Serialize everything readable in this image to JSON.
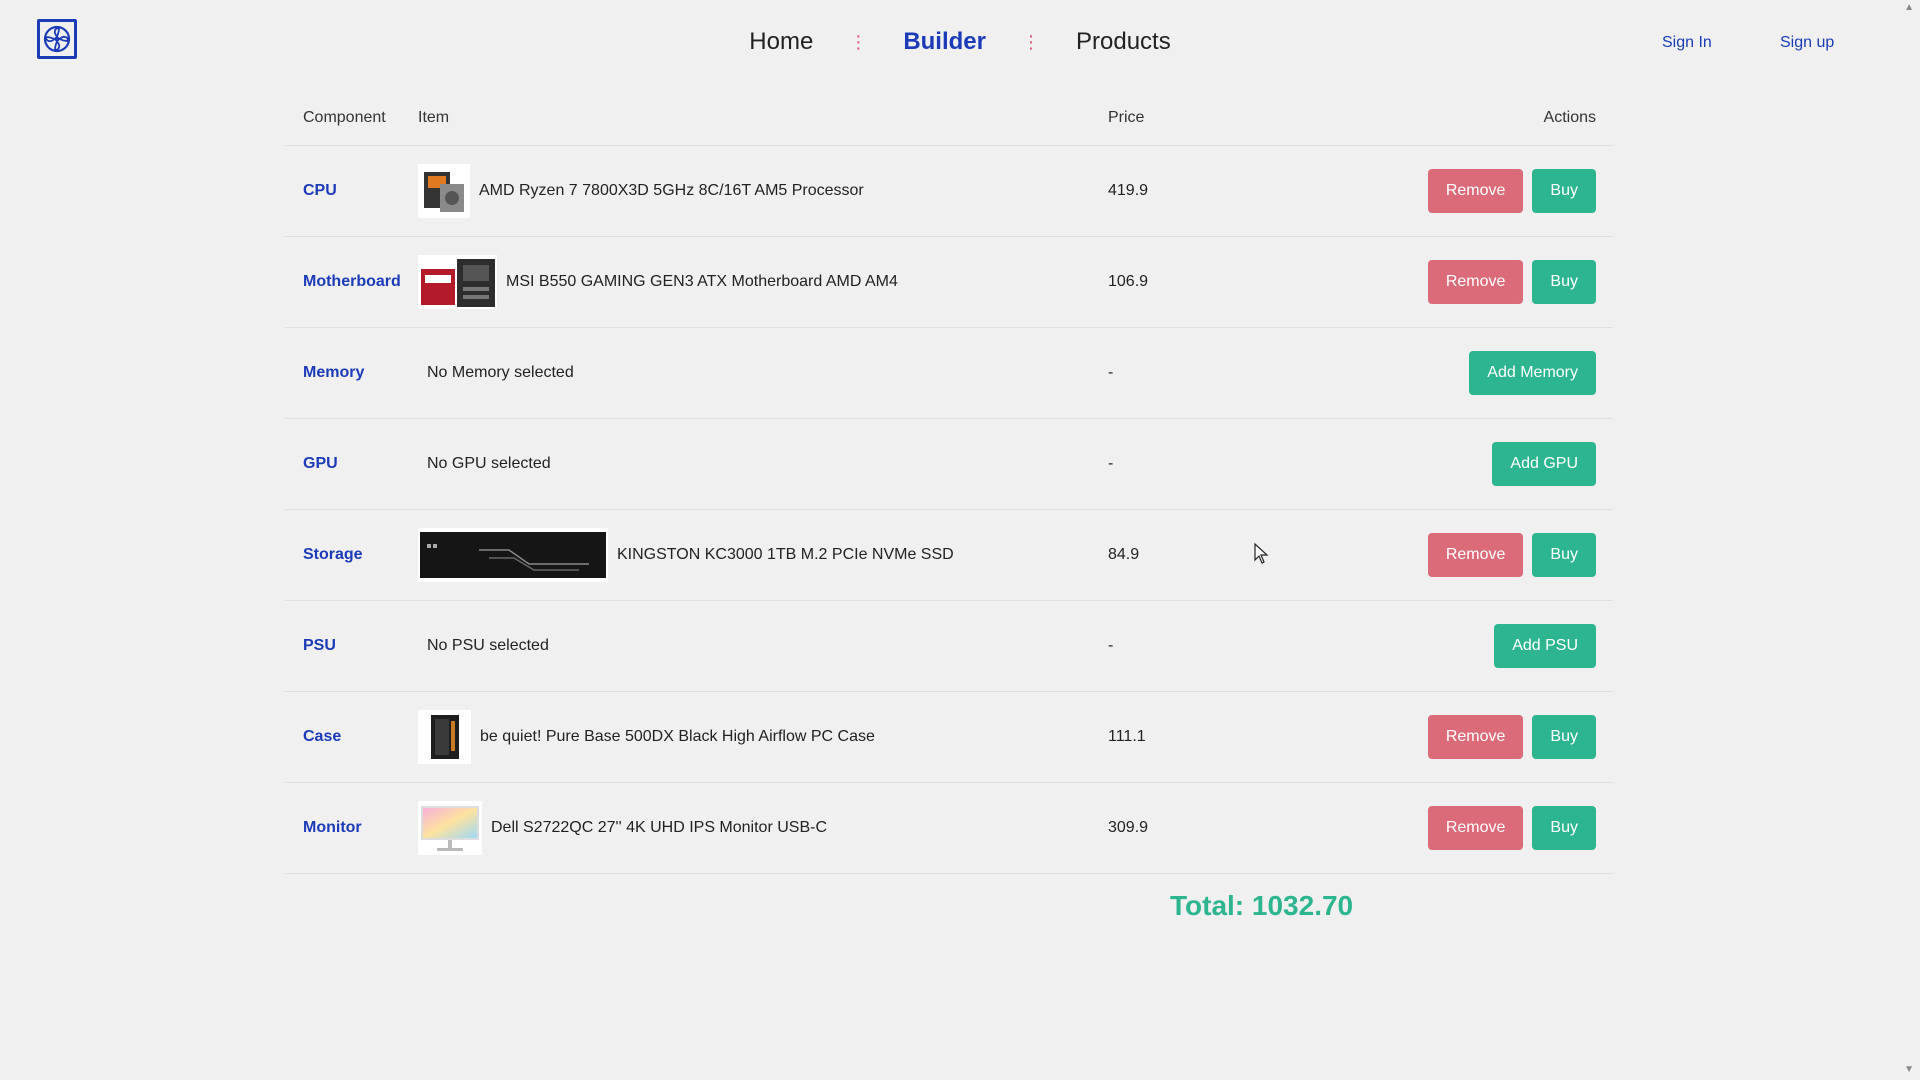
{
  "header": {
    "nav": [
      "Home",
      "Builder",
      "Products"
    ],
    "sign_in": "Sign In",
    "sign_up": "Sign up"
  },
  "table": {
    "headers": {
      "component": "Component",
      "item": "Item",
      "price": "Price",
      "actions": "Actions"
    },
    "rows": [
      {
        "component": "CPU",
        "item": "AMD Ryzen 7 7800X3D 5GHz 8C/16T AM5 Processor",
        "price": "419.9",
        "remove": "Remove",
        "buy": "Buy"
      },
      {
        "component": "Motherboard",
        "item": "MSI B550 GAMING GEN3 ATX Motherboard AMD AM4",
        "price": "106.9",
        "remove": "Remove",
        "buy": "Buy"
      },
      {
        "component": "Memory",
        "item": "No Memory selected",
        "price": "-",
        "add": "Add Memory"
      },
      {
        "component": "GPU",
        "item": "No GPU selected",
        "price": "-",
        "add": "Add GPU"
      },
      {
        "component": "Storage",
        "item": "KINGSTON KC3000 1TB M.2 PCIe NVMe SSD",
        "price": "84.9",
        "remove": "Remove",
        "buy": "Buy"
      },
      {
        "component": "PSU",
        "item": "No PSU selected",
        "price": "-",
        "add": "Add PSU"
      },
      {
        "component": "Case",
        "item": "be quiet! Pure Base 500DX Black High Airflow PC Case",
        "price": "111.1",
        "remove": "Remove",
        "buy": "Buy"
      },
      {
        "component": "Monitor",
        "item": "Dell S2722QC 27'' 4K UHD IPS Monitor USB-C",
        "price": "309.9",
        "remove": "Remove",
        "buy": "Buy"
      }
    ]
  },
  "total": "Total: 1032.70",
  "colors": {
    "accent": "#1c3bb8",
    "remove": "#dc6b7a",
    "buy": "#2db58f"
  }
}
